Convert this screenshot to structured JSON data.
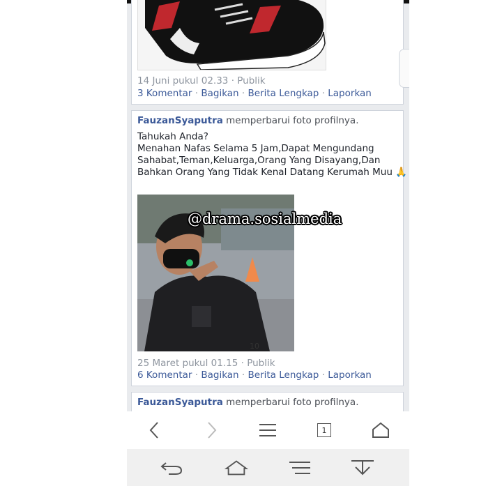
{
  "post1": {
    "timestamp": "14 Juni pukul 02.33",
    "privacy": "Publik",
    "comments": "3 Komentar",
    "share": "Bagikan",
    "full_story": "Berita Lengkap",
    "report": "Laporkan"
  },
  "post2": {
    "author": "FauzanSyaputra",
    "action": "memperbarui foto profilnya.",
    "text_lines": [
      "Tahukah Anda?",
      "Menahan Nafas Selama 5 Jam,Dapat Mengundang",
      "Sahabat,Teman,Keluarga,Orang Yang Disayang,Dan",
      "Bahkan Orang Yang Tidak Kenal Datang Kerumah Muu 🙏"
    ],
    "watermark": "@drama.sosialmedia",
    "photo_counter": "10",
    "timestamp": "25 Maret pukul 01.15",
    "privacy": "Publik",
    "comments": "6 Komentar",
    "share": "Bagikan",
    "full_story": "Berita Lengkap",
    "report": "Laporkan"
  },
  "post3": {
    "author": "FauzanSyaputra",
    "action": "memperbarui foto profilnya."
  },
  "browser_nav": {
    "tab_count": "1",
    "icons": [
      "back-arrow-icon",
      "forward-arrow-icon",
      "menu-icon",
      "tabs-icon",
      "home-icon"
    ]
  },
  "system_nav": {
    "icons": [
      "system-back-icon",
      "system-home-icon",
      "system-menu-icon",
      "system-download-icon"
    ]
  },
  "colors": {
    "link": "#3b5998",
    "meta": "#8d949e",
    "card_border": "#cfd4dc",
    "feed_bg": "#e9ebee"
  }
}
